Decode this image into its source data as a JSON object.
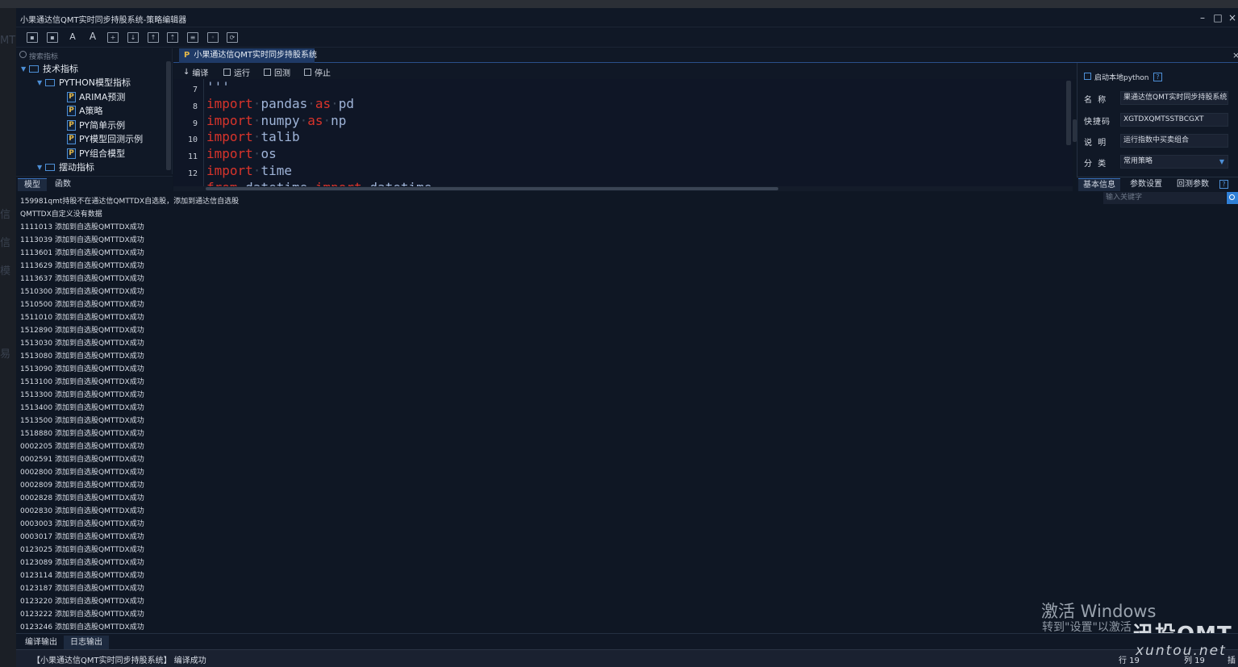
{
  "window": {
    "title": "小果通达信QMT实时同步持股系统-策略编辑器",
    "minimize": "–",
    "maximize": "□",
    "close": "×"
  },
  "background_ghost": [
    "MT",
    "信",
    "信",
    "模",
    "易"
  ],
  "toolbar": {
    "icons": [
      "save-icon",
      "save-all-icon",
      "font-decrease-icon",
      "font-increase-icon",
      "new-file-icon",
      "import-icon",
      "export-icon",
      "export-all-icon",
      "copy-icon",
      "find-icon",
      "replace-icon"
    ],
    "font_small": "A",
    "font_large": "A"
  },
  "tree": {
    "search_placeholder": "搜索指标",
    "items": [
      {
        "label": "技术指标",
        "type": "folder"
      },
      {
        "label": "PYTHON模型指标",
        "type": "folder"
      },
      {
        "label": "ARIMA预测",
        "type": "py"
      },
      {
        "label": "A策略",
        "type": "py"
      },
      {
        "label": "PY简单示例",
        "type": "py"
      },
      {
        "label": "PY模型回测示例",
        "type": "py"
      },
      {
        "label": "PY组合模型",
        "type": "py"
      },
      {
        "label": "摆动指标",
        "type": "folder"
      }
    ],
    "py_badge": "P"
  },
  "left_tabs": [
    "模型",
    "函数"
  ],
  "editor": {
    "tab_label": "小果通达信QMT实时同步持股系统",
    "tab_badge": "P",
    "actions": [
      "编译",
      "运行",
      "回测",
      "停止"
    ],
    "lines": [
      {
        "n": "7",
        "parts": [
          {
            "t": "'''",
            "k": "str"
          }
        ]
      },
      {
        "n": "8",
        "parts": [
          {
            "t": "import",
            "k": "kw"
          },
          {
            "t": "·",
            "k": "dot"
          },
          {
            "t": "pandas",
            "k": "id"
          },
          {
            "t": "·",
            "k": "dot"
          },
          {
            "t": "as",
            "k": "kw"
          },
          {
            "t": "·",
            "k": "dot"
          },
          {
            "t": "pd",
            "k": "id"
          }
        ]
      },
      {
        "n": "9",
        "parts": [
          {
            "t": "import",
            "k": "kw"
          },
          {
            "t": "·",
            "k": "dot"
          },
          {
            "t": "numpy",
            "k": "id"
          },
          {
            "t": "·",
            "k": "dot"
          },
          {
            "t": "as",
            "k": "kw"
          },
          {
            "t": "·",
            "k": "dot"
          },
          {
            "t": "np",
            "k": "id"
          }
        ]
      },
      {
        "n": "10",
        "parts": [
          {
            "t": "import",
            "k": "kw"
          },
          {
            "t": "·",
            "k": "dot"
          },
          {
            "t": "talib",
            "k": "id"
          }
        ]
      },
      {
        "n": "11",
        "parts": [
          {
            "t": "import",
            "k": "kw"
          },
          {
            "t": "·",
            "k": "dot"
          },
          {
            "t": "os",
            "k": "id"
          }
        ]
      },
      {
        "n": "12",
        "parts": [
          {
            "t": "import",
            "k": "kw"
          },
          {
            "t": "·",
            "k": "dot"
          },
          {
            "t": "time",
            "k": "id"
          }
        ]
      },
      {
        "n": "13",
        "parts": [
          {
            "t": "from",
            "k": "kw"
          },
          {
            "t": "·",
            "k": "dot"
          },
          {
            "t": "datetime",
            "k": "id"
          },
          {
            "t": "·",
            "k": "dot"
          },
          {
            "t": "import",
            "k": "kw"
          },
          {
            "t": "·",
            "k": "dot"
          },
          {
            "t": "datetime",
            "k": "id"
          }
        ]
      }
    ]
  },
  "props": {
    "enable_local_python": "启动本地python",
    "help": "?",
    "fields": [
      {
        "label": "名  称",
        "value": "果通达信QMT实时同步持股系统"
      },
      {
        "label": "快捷码",
        "value": "XGTDXQMTSSTBCGXT"
      },
      {
        "label": "说  明",
        "value": "运行指数中买卖组合"
      },
      {
        "label": "分  类",
        "value": "常用策略"
      }
    ],
    "tabs": [
      "基本信息",
      "参数设置",
      "回测参数"
    ],
    "keyword_placeholder": "输入关键字"
  },
  "output": {
    "lines": [
      "159981qmt持股不在通达信QMTTDX自选股，添加到通达信自选股",
      "QMTTDX自定义没有数据",
      "1111013 添加到自选股QMTTDX成功",
      "1113039 添加到自选股QMTTDX成功",
      "1113601 添加到自选股QMTTDX成功",
      "1113629 添加到自选股QMTTDX成功",
      "1113637 添加到自选股QMTTDX成功",
      "1510300 添加到自选股QMTTDX成功",
      "1510500 添加到自选股QMTTDX成功",
      "1511010 添加到自选股QMTTDX成功",
      "1512890 添加到自选股QMTTDX成功",
      "1513030 添加到自选股QMTTDX成功",
      "1513080 添加到自选股QMTTDX成功",
      "1513090 添加到自选股QMTTDX成功",
      "1513100 添加到自选股QMTTDX成功",
      "1513300 添加到自选股QMTTDX成功",
      "1513400 添加到自选股QMTTDX成功",
      "1513500 添加到自选股QMTTDX成功",
      "1518880 添加到自选股QMTTDX成功",
      "0002205 添加到自选股QMTTDX成功",
      "0002591 添加到自选股QMTTDX成功",
      "0002800 添加到自选股QMTTDX成功",
      "0002809 添加到自选股QMTTDX成功",
      "0002828 添加到自选股QMTTDX成功",
      "0002830 添加到自选股QMTTDX成功",
      "0003003 添加到自选股QMTTDX成功",
      "0003017 添加到自选股QMTTDX成功",
      "0123025 添加到自选股QMTTDX成功",
      "0123089 添加到自选股QMTTDX成功",
      "0123114 添加到自选股QMTTDX成功",
      "0123187 添加到自选股QMTTDX成功",
      "0123220 添加到自选股QMTTDX成功",
      "0123222 添加到自选股QMTTDX成功",
      "0123246 添加到自选股QMTTDX成功"
    ]
  },
  "bottom_tabs": [
    "编译输出",
    "日志输出"
  ],
  "status": {
    "message": "【小果通达信QMT实时同步持股系统】 编译成功",
    "row": "行 19",
    "col": "列 19",
    "extra": "插"
  },
  "watermark": {
    "activate": "激活 Windows",
    "activate_hint": "转到\"设置\"以激活",
    "brand": "迅投QMT",
    "site": "xuntou.net"
  }
}
